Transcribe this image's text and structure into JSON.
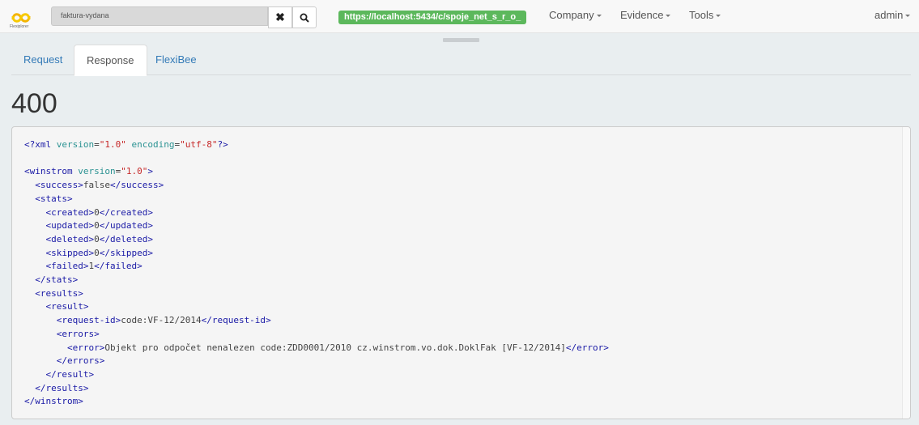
{
  "app": {
    "logo_text": "Flexiplorer"
  },
  "toolbar": {
    "search_value": "faktura-vydana",
    "url_badge": "https://localhost:5434/c/spoje_net_s_r_o_",
    "menus": [
      "Company",
      "Evidence",
      "Tools"
    ],
    "user": "admin"
  },
  "tabs": [
    {
      "label": "Request",
      "active": false
    },
    {
      "label": "Response",
      "active": true
    },
    {
      "label": "FlexiBee",
      "active": false
    }
  ],
  "response": {
    "status_code": "400",
    "xml": {
      "declaration": {
        "version": "1.0",
        "encoding": "utf-8"
      },
      "root_tag": "winstrom",
      "root_version": "1.0",
      "success_tag": "success",
      "success": "false",
      "stats_tag": "stats",
      "stats": [
        {
          "tag": "created",
          "value": "0"
        },
        {
          "tag": "updated",
          "value": "0"
        },
        {
          "tag": "deleted",
          "value": "0"
        },
        {
          "tag": "skipped",
          "value": "0"
        },
        {
          "tag": "failed",
          "value": "1"
        }
      ],
      "results_tag": "results",
      "result_tag": "result",
      "request_id_tag": "request-id",
      "request_id": "code:VF-12/2014",
      "errors_tag": "errors",
      "error_tag": "error",
      "error": "Objekt pro odpočet nenalezen code:ZDD0001/2010 cz.winstrom.vo.dok.DoklFak [VF-12/2014]"
    }
  },
  "colors": {
    "url_badge": "#5cb85c",
    "tab_link": "#337ab7",
    "xml_tag": "#1a1aa6",
    "xml_attr": "#2a9292",
    "xml_value": "#c62828"
  }
}
